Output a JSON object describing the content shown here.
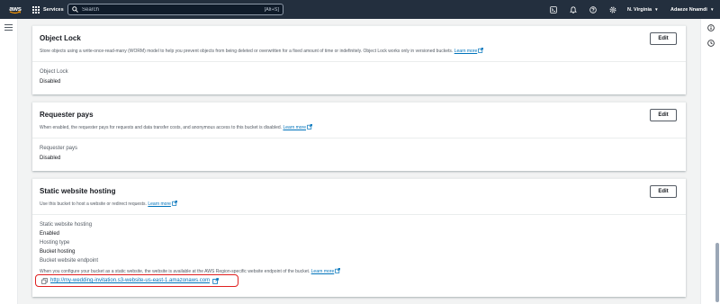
{
  "nav": {
    "logo_text": "aws",
    "services_label": "Services",
    "search_placeholder": "Search",
    "search_shortcut": "[Alt+S]",
    "region": "N. Virginia",
    "user": "Adaeze Nnamdi"
  },
  "object_lock": {
    "title": "Object Lock",
    "description": "Store objects using a write-once-read-many (WORM) model to help you prevent objects from being deleted or overwritten for a fixed amount of time or indefinitely. Object Lock works only in versioned buckets.",
    "learn_more": "Learn more",
    "edit_label": "Edit",
    "field_label": "Object Lock",
    "field_value": "Disabled"
  },
  "requester_pays": {
    "title": "Requester pays",
    "description": "When enabled, the requester pays for requests and data transfer costs, and anonymous access to this bucket is disabled.",
    "learn_more": "Learn more",
    "edit_label": "Edit",
    "field_label": "Requester pays",
    "field_value": "Disabled"
  },
  "static_hosting": {
    "title": "Static website hosting",
    "description": "Use this bucket to host a website or redirect requests.",
    "learn_more": "Learn more",
    "edit_label": "Edit",
    "hosting_label": "Static website hosting",
    "hosting_value": "Enabled",
    "type_label": "Hosting type",
    "type_value": "Bucket hosting",
    "endpoint_label": "Bucket website endpoint",
    "endpoint_hint": "When you configure your bucket as a static website, the website is available at the AWS Region-specific website endpoint of the bucket.",
    "endpoint_hint_link": "Learn more",
    "endpoint_url": "http://my-wedding-invitation.s3-website-us-east-1.amazonaws.com"
  },
  "icons": {
    "cloudshell": "cloudshell-icon",
    "notifications": "bell-icon",
    "help": "help-icon",
    "settings": "gear-icon"
  },
  "colors": {
    "nav_bg": "#232f3e",
    "link": "#0073bb",
    "highlight": "#e02020",
    "page_bg": "#f2f3f3"
  }
}
